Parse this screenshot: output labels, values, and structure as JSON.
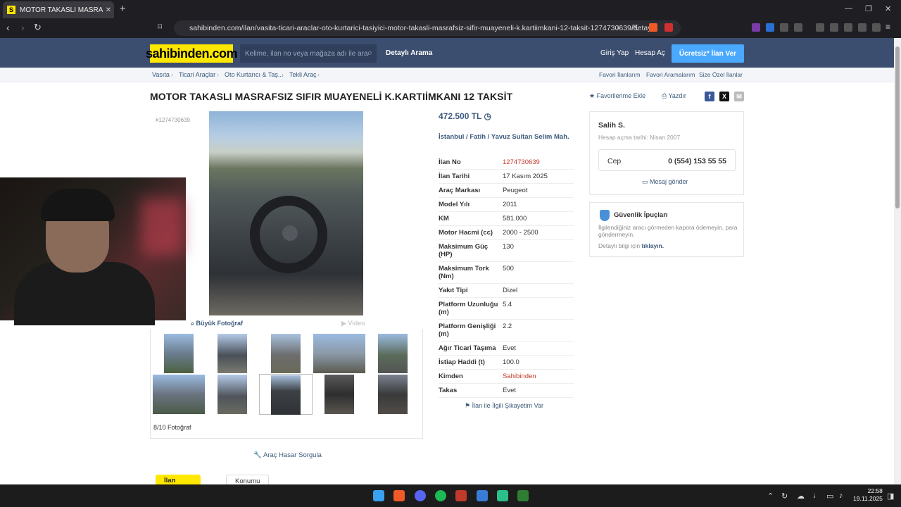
{
  "browser": {
    "tab_title": "MOTOR TAKASLI MASRAFSIZ SI",
    "tab_close": "✕",
    "favicon_letter": "S",
    "url": "sahibinden.com/ilan/vasita-ticari-araclar-oto-kurtarici-tasiyici-motor-takasli-masrafsiz-sifir-muayeneli-k.kartiimkani-12-taksit-1274730639/detay"
  },
  "header": {
    "logo": "sahibinden.com",
    "search_placeholder": "Kelime, ilan no veya mağaza adı ile ara",
    "advanced_search": "Detaylı Arama",
    "login": "Giriş Yap",
    "register": "Hesap Aç",
    "post_ad": "Ücretsiz* İlan Ver"
  },
  "breadcrumbs": [
    "Vasıta",
    "Ticari Araçlar",
    "Oto Kurtarıcı & Taş...",
    "Tekli Araç"
  ],
  "breadcrumb_links": [
    "Favori İlanlarım",
    "Favori Aramalarım",
    "Size Özel İlanlar"
  ],
  "listing": {
    "title": "MOTOR TAKASLI MASRAFSIZ SIFIR MUAYENELİ K.KARTIİMKANI 12 TAKSİT",
    "fav_label": "Favorilerime Ekle",
    "print_label": "Yazdır",
    "ad_id_label": "#1274730639",
    "big_photo": "Büyük Fotoğraf",
    "video": "Video",
    "photo_count": "8/10 Fotoğraf",
    "damage_query": "Araç Hasar Sorgula",
    "price": "472.500 TL",
    "location": "İstanbul  /  Fatih  /  Yavuz Sultan Selim Mah.",
    "complaint": "İlan ile İlgili Şikayetim Var",
    "bottom_tabs": [
      "İlan Detayları",
      "Konumu"
    ]
  },
  "details": [
    {
      "k": "İlan No",
      "v": "1274730639"
    },
    {
      "k": "İlan Tarihi",
      "v": "17 Kasım 2025"
    },
    {
      "k": "Araç Markası",
      "v": "Peugeot"
    },
    {
      "k": "Model Yılı",
      "v": "2011"
    },
    {
      "k": "KM",
      "v": "581.000"
    },
    {
      "k": "Motor Hacmi (cc)",
      "v": "2000 - 2500"
    },
    {
      "k": "Maksimum Güç (HP)",
      "v": "130"
    },
    {
      "k": "Maksimum Tork (Nm)",
      "v": "500"
    },
    {
      "k": "Yakıt Tipi",
      "v": "Dizel"
    },
    {
      "k": "Platform Uzunluğu (m)",
      "v": "5.4"
    },
    {
      "k": "Platform Genişliği (m)",
      "v": "2.2"
    },
    {
      "k": "Ağır Ticari Taşıma",
      "v": "Evet"
    },
    {
      "k": "İstiap Haddi (t)",
      "v": "100.0"
    },
    {
      "k": "Kimden",
      "v": "Sahibinden"
    },
    {
      "k": "Takas",
      "v": "Evet"
    }
  ],
  "seller": {
    "name": "Salih S.",
    "since": "Hesap açma tarihi: Nisan 2007",
    "phone_label": "Cep",
    "phone": "0 (554) 153 55 55",
    "message": "Mesaj gönder"
  },
  "safety": {
    "title": "Güvenlik İpuçları",
    "text": "İlgilendiğiniz aracı görmeden kapora ödemeyin, para göndermeyin.",
    "link_prefix": "Detaylı bilgi için",
    "link": "tıklayın."
  },
  "taskbar": {
    "time": "22:58",
    "date": "19.11.2025"
  },
  "colors": {
    "accent": "#ffe800",
    "header": "#3c4e6f",
    "link": "#3d5a7d",
    "cta": "#4aa9ff"
  }
}
